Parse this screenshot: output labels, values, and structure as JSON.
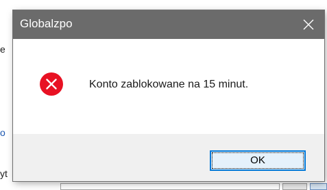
{
  "dialog": {
    "title": "Globalzpo",
    "close_icon": "close-icon",
    "message_icon": "error-icon",
    "message": "Konto zablokowane na 15 minut.",
    "ok_label": "OK"
  },
  "background": {
    "fragment_1": "e",
    "fragment_2": "o",
    "fragment_3": "yt"
  },
  "colors": {
    "titlebar": "#6b6b6b",
    "error_red": "#e81123",
    "accent": "#0078d7",
    "footer": "#f0f0f0"
  }
}
